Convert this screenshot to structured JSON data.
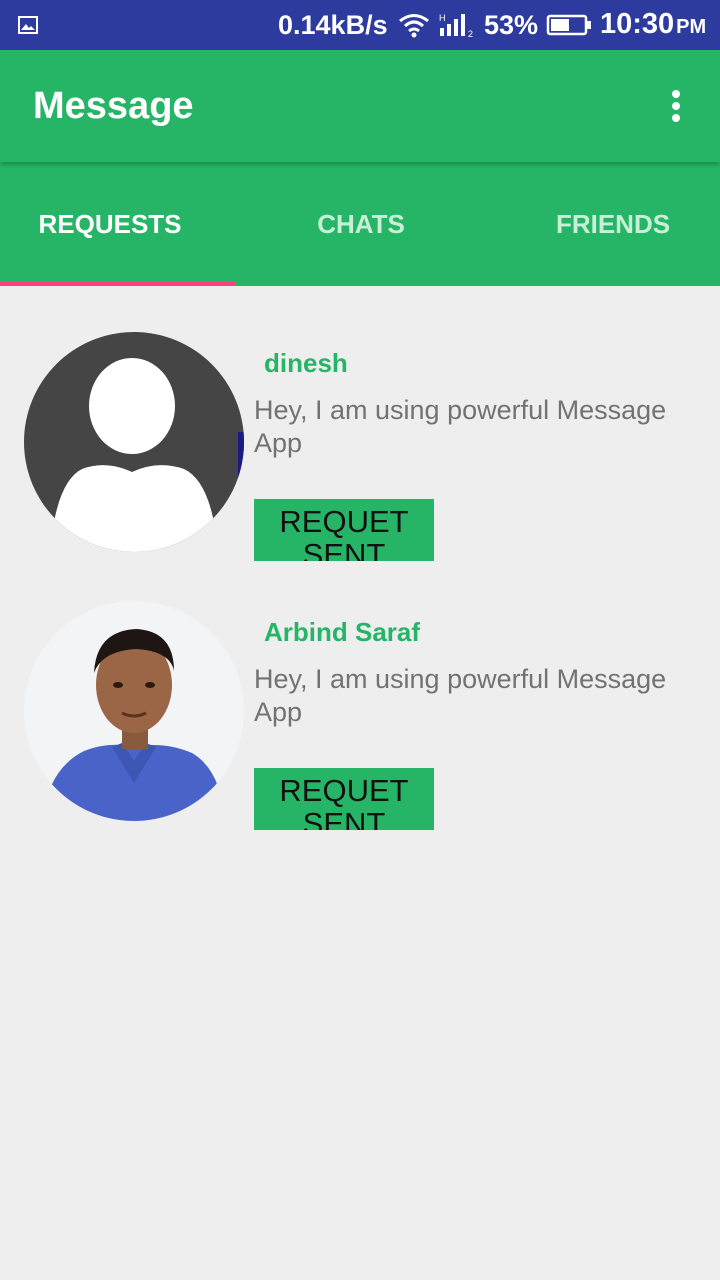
{
  "status_bar": {
    "net_speed": "0.14kB/s",
    "battery": "53%",
    "time": "10:30",
    "ampm": "PM"
  },
  "app_bar": {
    "title": "Message"
  },
  "tabs": [
    {
      "label": "REQUESTS",
      "selected": true
    },
    {
      "label": "CHATS",
      "selected": false
    },
    {
      "label": "FRIENDS",
      "selected": false
    }
  ],
  "requests": [
    {
      "name": "dinesh",
      "status": "Hey, I am using powerful Message App",
      "button": "REQUET SENT"
    },
    {
      "name": "Arbind Saraf",
      "status": "Hey, I am using powerful Message App",
      "button": "REQUET SENT"
    }
  ],
  "colors": {
    "primary": "#26b567",
    "status_bar": "#2e3b9e",
    "indicator": "#ff4081",
    "background": "#eeeeee"
  }
}
